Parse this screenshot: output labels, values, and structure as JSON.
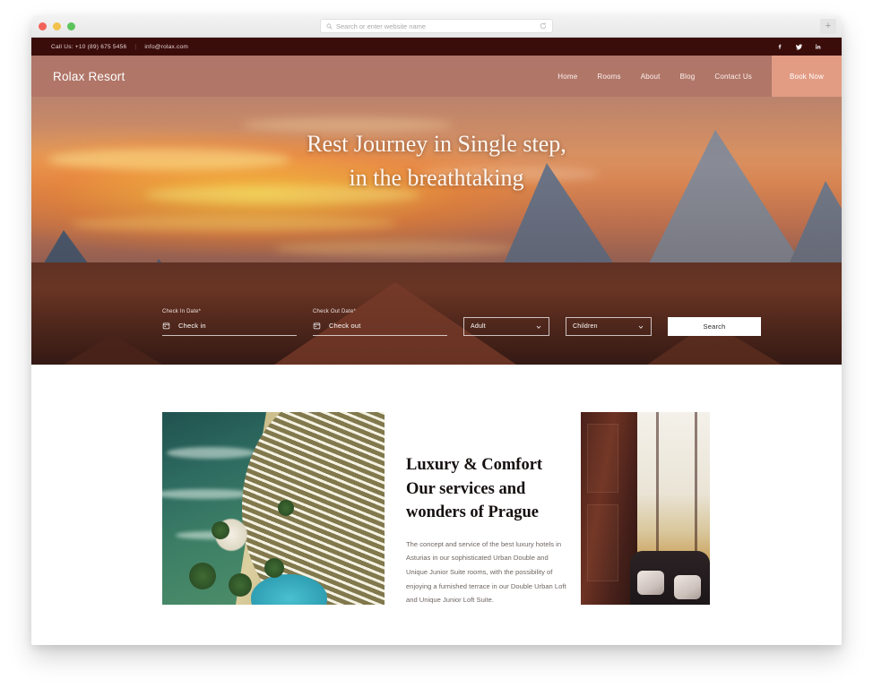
{
  "browser": {
    "url_placeholder": "Search or enter website name",
    "search_icon": "search-icon",
    "reload_icon": "reload-icon",
    "newtab_label": "+"
  },
  "topbar": {
    "phone": "Call Us:  +10 (89) 675 5456",
    "divider": "|",
    "email": "info@rolax.com",
    "socials": [
      {
        "name": "facebook-icon",
        "glyph": "f"
      },
      {
        "name": "twitter-icon",
        "glyph": "t"
      },
      {
        "name": "linkedin-icon",
        "glyph": "in"
      }
    ]
  },
  "header": {
    "brand": "Rolax Resort",
    "nav": [
      {
        "label": "Home"
      },
      {
        "label": "Rooms"
      },
      {
        "label": "About"
      },
      {
        "label": "Blog"
      },
      {
        "label": "Contact Us"
      }
    ],
    "cta": "Book Now",
    "cta_color": "#e29c84",
    "bar_color": "#b07467",
    "topbar_color": "#3a0d0b"
  },
  "hero": {
    "title_line1": "Rest Journey in Single step,",
    "title_line2": "in the breathtaking"
  },
  "booking": {
    "checkin": {
      "label": "Check In Date*",
      "placeholder": "Check in",
      "icon": "calendar-icon"
    },
    "checkout": {
      "label": "Check Out Date*",
      "placeholder": "Check out",
      "icon": "calendar-icon"
    },
    "adult_select": {
      "value": "Adult",
      "icon": "chevron-down-icon"
    },
    "children_select": {
      "value": "Children",
      "icon": "chevron-down-icon"
    },
    "search_button": "Search"
  },
  "section": {
    "heading_line1": "Luxury & Comfort",
    "heading_line2": "Our services and",
    "heading_line3": "wonders of Prague",
    "paragraph": "The concept and service of the best luxury hotels in Asturias in our sophisticated Urban Double and Unique Junior Suite rooms, with the possibility of enjoying a furnished terrace in our Double Urban Loft and Unique Junior Loft Suite.",
    "image_left_alt": "aerial-resort-photo",
    "image_right_alt": "hotel-room-photo"
  }
}
